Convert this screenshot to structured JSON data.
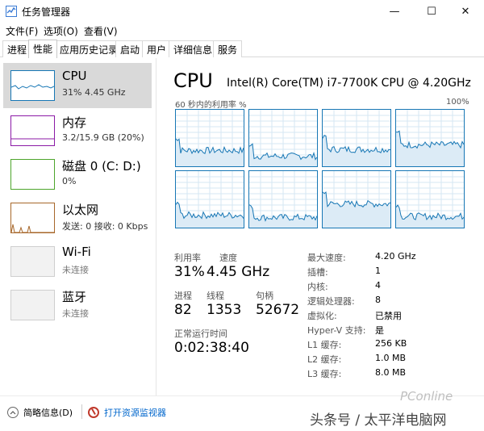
{
  "window": {
    "title": "任务管理器",
    "minimize_glyph": "—",
    "maximize_glyph": "☐",
    "close_glyph": "✕"
  },
  "menu": [
    "文件(F)",
    "选项(O)",
    "查看(V)"
  ],
  "tabs": [
    "进程",
    "性能",
    "应用历史记录",
    "启动",
    "用户",
    "详细信息",
    "服务"
  ],
  "active_tab": "性能",
  "sidebar": {
    "items": [
      {
        "name": "CPU",
        "sub": "31% 4.45 GHz",
        "color": "#1777b5",
        "icon": "cpu-graph-icon"
      },
      {
        "name": "内存",
        "sub": "3.2/15.9 GB (20%)",
        "color": "#8b1aa6",
        "icon": "memory-graph-icon"
      },
      {
        "name": "磁盘 0 (C: D:)",
        "sub": "0%",
        "color": "#4da52b",
        "icon": "disk-graph-icon"
      },
      {
        "name": "以太网",
        "sub": "发送: 0 接收: 0 Kbps",
        "color": "#a7672a",
        "icon": "ethernet-graph-icon"
      },
      {
        "name": "Wi-Fi",
        "sub": "未连接",
        "color": "#bdbdbd",
        "icon": "wifi-graph-icon"
      },
      {
        "name": "蓝牙",
        "sub": "未连接",
        "color": "#bdbdbd",
        "icon": "bluetooth-graph-icon"
      }
    ]
  },
  "cpu": {
    "title": "CPU",
    "model": "Intel(R) Core(TM) i7-7700K CPU @ 4.20GHz",
    "graph_caption": "60 秒内的利用率 %",
    "graph_max": "100%",
    "line_color": "#1777b5",
    "fill_color": "#dcebf6",
    "core_levels": [
      0.28,
      0.18,
      0.3,
      0.38,
      0.22,
      0.18,
      0.42,
      0.2
    ]
  },
  "stats": {
    "utilization_label": "利用率",
    "utilization": "31%",
    "speed_label": "速度",
    "speed": "4.45 GHz",
    "processes_label": "进程",
    "processes": "82",
    "threads_label": "线程",
    "threads": "1353",
    "handles_label": "句柄",
    "handles": "52672",
    "uptime_label": "正常运行时间",
    "uptime": "0:02:38:40"
  },
  "specs": [
    {
      "label": "最大速度:",
      "value": "4.20 GHz"
    },
    {
      "label": "插槽:",
      "value": "1"
    },
    {
      "label": "内核:",
      "value": "4"
    },
    {
      "label": "逻辑处理器:",
      "value": "8"
    },
    {
      "label": "虚拟化:",
      "value": "已禁用"
    },
    {
      "label": "Hyper-V 支持:",
      "value": "是"
    },
    {
      "label": "L1 缓存:",
      "value": "256 KB"
    },
    {
      "label": "L2 缓存:",
      "value": "1.0 MB"
    },
    {
      "label": "L3 缓存:",
      "value": "8.0 MB"
    }
  ],
  "footer": {
    "summary": "简略信息(D)",
    "summary_icon": "chevron-up-icon",
    "resource_monitor": "打开资源监视器",
    "resource_monitor_icon": "resource-monitor-icon"
  },
  "watermark": {
    "text": "头条号 / 太平洋电脑网",
    "brand": "PConline"
  }
}
